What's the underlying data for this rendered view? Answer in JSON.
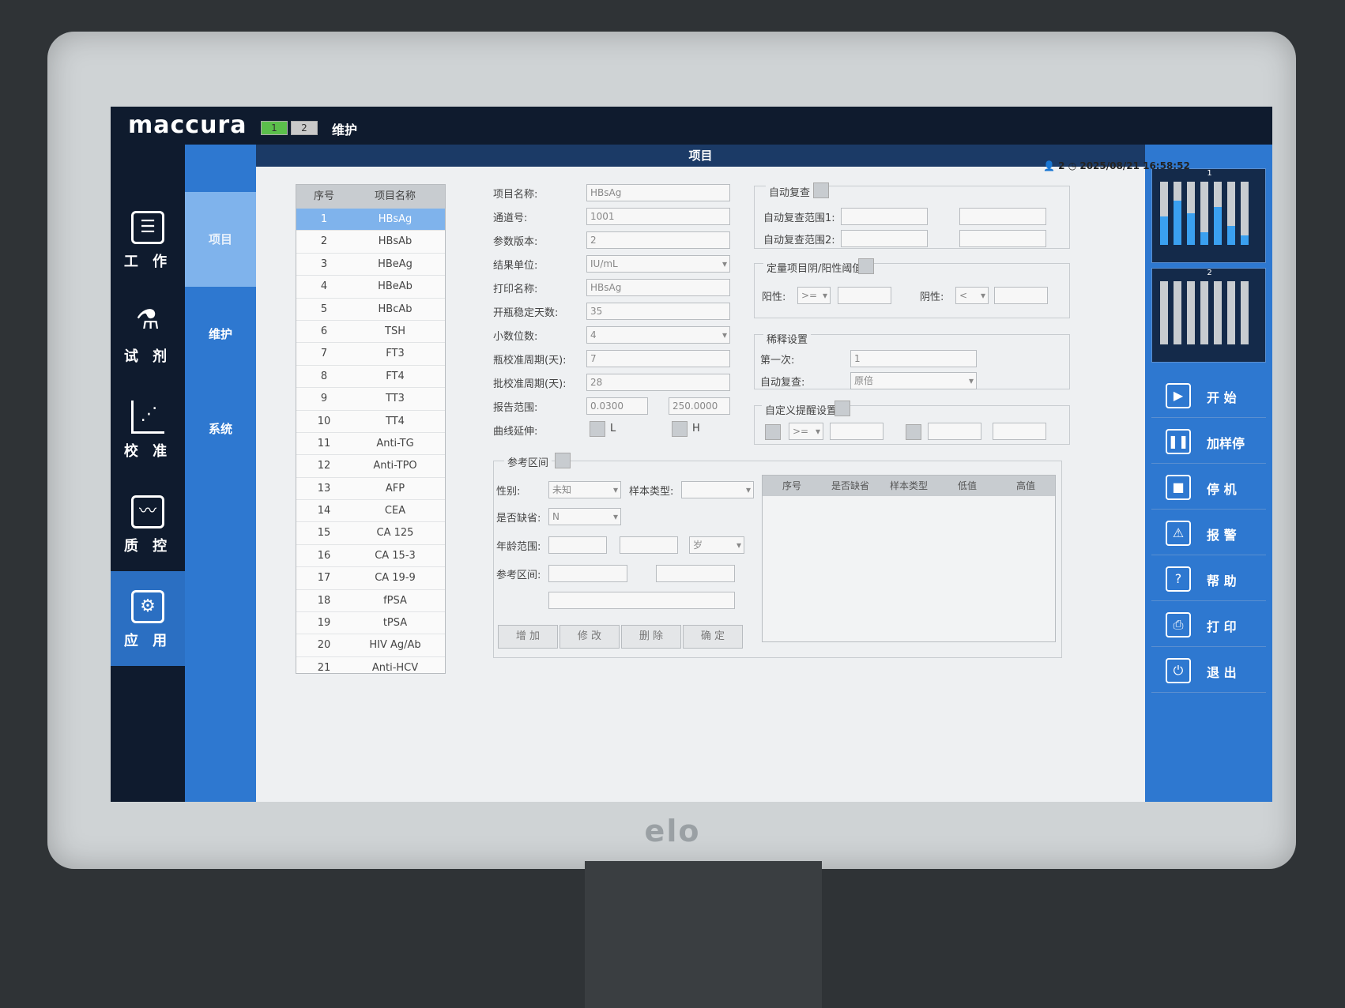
{
  "header": {
    "logo": "maccura",
    "tab1": "1",
    "tab2": "2",
    "breadcrumb": "维护",
    "page_title": "项目"
  },
  "status": {
    "user_count": "2",
    "datetime": "2025/08/21 16:58:52"
  },
  "nav": [
    {
      "label": "工 作",
      "icon": "clipboard-icon"
    },
    {
      "label": "试 剂",
      "icon": "flask-icon"
    },
    {
      "label": "校 准",
      "icon": "calibration-chart-icon"
    },
    {
      "label": "质 控",
      "icon": "qc-waveform-icon"
    },
    {
      "label": "应 用",
      "icon": "gear-icon"
    }
  ],
  "subnav": [
    "项目",
    "维护",
    "系统"
  ],
  "list": {
    "headers": [
      "序号",
      "项目名称"
    ],
    "rows": [
      [
        "1",
        "HBsAg"
      ],
      [
        "2",
        "HBsAb"
      ],
      [
        "3",
        "HBeAg"
      ],
      [
        "4",
        "HBeAb"
      ],
      [
        "5",
        "HBcAb"
      ],
      [
        "6",
        "TSH"
      ],
      [
        "7",
        "FT3"
      ],
      [
        "8",
        "FT4"
      ],
      [
        "9",
        "TT3"
      ],
      [
        "10",
        "TT4"
      ],
      [
        "11",
        "Anti-TG"
      ],
      [
        "12",
        "Anti-TPO"
      ],
      [
        "13",
        "AFP"
      ],
      [
        "14",
        "CEA"
      ],
      [
        "15",
        "CA 125"
      ],
      [
        "16",
        "CA 15-3"
      ],
      [
        "17",
        "CA 19-9"
      ],
      [
        "18",
        "fPSA"
      ],
      [
        "19",
        "tPSA"
      ],
      [
        "20",
        "HIV Ag/Ab"
      ],
      [
        "21",
        "Anti-HCV"
      ]
    ]
  },
  "form": {
    "item_name_label": "项目名称:",
    "item_name": "HBsAg",
    "channel_label": "通道号:",
    "channel": "1001",
    "param_version_label": "参数版本:",
    "param_version": "2",
    "unit_label": "结果单位:",
    "unit": "IU/mL",
    "print_name_label": "打印名称:",
    "print_name": "HBsAg",
    "open_days_label": "开瓶稳定天数:",
    "open_days": "35",
    "decimals_label": "小数位数:",
    "decimals": "4",
    "bottle_cal_label": "瓶校准周期(天):",
    "bottle_cal": "7",
    "lot_cal_label": "批校准周期(天):",
    "lot_cal": "28",
    "report_range_label": "报告范围:",
    "report_low": "0.0300",
    "report_high": "250.0000",
    "curve_ext_label": "曲线延伸:",
    "curve_l": "L",
    "curve_h": "H"
  },
  "auto_recheck": {
    "title": "自动复查",
    "range1_label": "自动复查范围1:",
    "range2_label": "自动复查范围2:"
  },
  "threshold": {
    "title": "定量项目阴/阳性阈值",
    "positive_label": "阳性:",
    "positive_op": ">=",
    "negative_label": "阴性:",
    "negative_op": "<"
  },
  "dilution": {
    "title": "稀释设置",
    "first_label": "第一次:",
    "first": "1",
    "recheck_label": "自动复查:",
    "recheck": "原倍"
  },
  "reminder": {
    "title": "自定义提醒设置",
    "op": ">="
  },
  "reference": {
    "title": "参考区间",
    "gender_label": "性别:",
    "gender": "未知",
    "sample_type_label": "样本类型:",
    "default_label": "是否缺省:",
    "default": "N",
    "age_label": "年龄范围:",
    "age_unit": "岁",
    "range_label": "参考区间:",
    "buttons": [
      "增 加",
      "修 改",
      "删 除",
      "确 定"
    ],
    "grid_headers": [
      "序号",
      "是否缺省",
      "样本类型",
      "低值",
      "高值"
    ]
  },
  "tube_panel": {
    "rack1": "1",
    "rack2": "2",
    "levels1": [
      0.45,
      0.7,
      0.5,
      0.2,
      0.6,
      0.3,
      0.15
    ],
    "levels2": [
      0.0,
      0.0,
      0.0,
      0.0,
      0.0,
      0.0,
      0.0
    ]
  },
  "actions": [
    {
      "label": "开 始",
      "icon": "play-icon"
    },
    {
      "label": "加样停",
      "icon": "pause-icon"
    },
    {
      "label": "停 机",
      "icon": "stop-icon"
    },
    {
      "label": "报 警",
      "icon": "warning-icon"
    },
    {
      "label": "帮 助",
      "icon": "help-icon"
    },
    {
      "label": "打 印",
      "icon": "printer-icon"
    },
    {
      "label": "退 出",
      "icon": "power-icon"
    }
  ],
  "monitor_brand": "elo"
}
